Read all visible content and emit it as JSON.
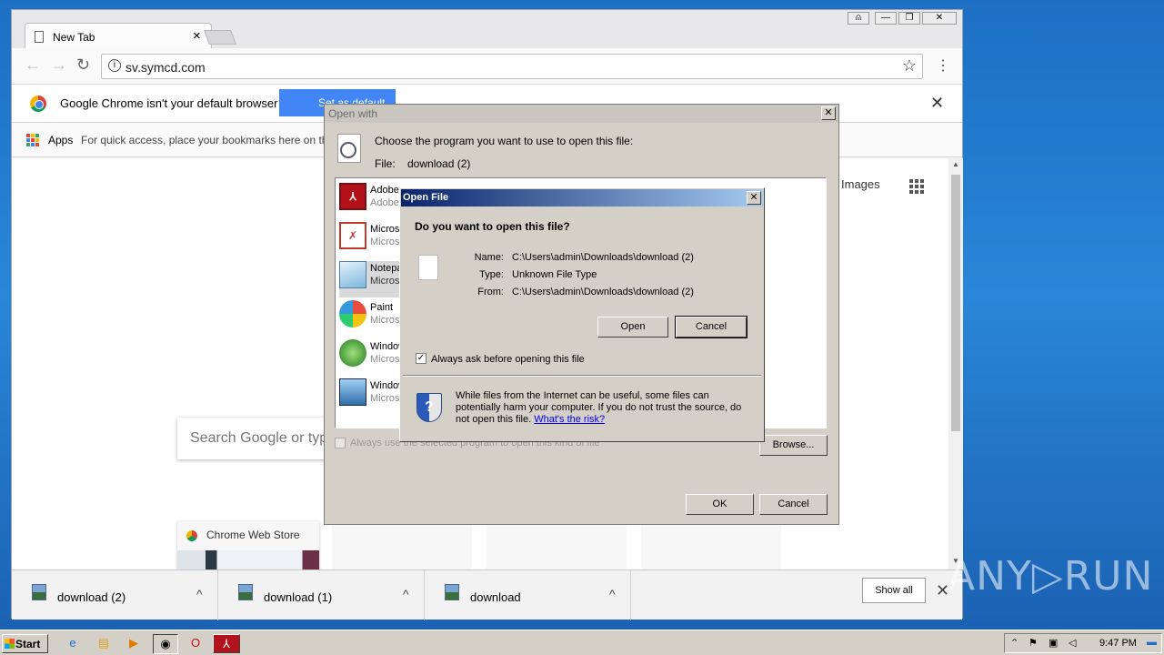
{
  "browser": {
    "tab_title": "New Tab",
    "tab_close": "×",
    "url": "sv.symcd.com",
    "window_controls": {
      "user": "⍝",
      "minimize": "—",
      "restore": "❐",
      "close": "✕"
    },
    "infobar": {
      "message": "Google Chrome isn't your default browser",
      "set_default_label": "Set as default"
    },
    "bookmarks": {
      "apps_label": "Apps",
      "hint": "For quick access, place your bookmarks here on the bookmarks bar."
    },
    "new_tab_page": {
      "images_link": "Images",
      "search_placeholder": "Search Google or type URL",
      "tiles": [
        {
          "label": "Chrome Web Store"
        }
      ]
    },
    "downloads": {
      "items": [
        {
          "name": "download (2)"
        },
        {
          "name": "download (1)"
        },
        {
          "name": "download"
        }
      ],
      "show_all": "Show all"
    }
  },
  "open_with_dialog": {
    "title": "Open with",
    "prompt": "Choose the program you want to use to open this file:",
    "file_label": "File:",
    "file_name": "download (2)",
    "programs": [
      {
        "name": "Adobe",
        "vendor": "Adobe",
        "icon": "adobe-pdf-icon"
      },
      {
        "name": "Microsoft",
        "vendor": "Microsoft",
        "icon": "office-icon"
      },
      {
        "name": "Notepad",
        "vendor": "Microsoft",
        "icon": "notepad-icon"
      },
      {
        "name": "Paint",
        "vendor": "Microsoft",
        "icon": "paint-icon"
      },
      {
        "name": "Windows",
        "vendor": "Microsoft",
        "icon": "windows-media-icon"
      },
      {
        "name": "Windows",
        "vendor": "Microsoft",
        "icon": "photo-viewer-icon"
      }
    ],
    "always_use_label": "Always use the selected program to open this kind of file",
    "browse_button": "Browse...",
    "ok_button": "OK",
    "cancel_button": "Cancel"
  },
  "open_file_dialog": {
    "title": "Open File",
    "question": "Do you want to open this file?",
    "fields": [
      {
        "key": "Name:",
        "value": "C:\\Users\\admin\\Downloads\\download (2)"
      },
      {
        "key": "Type:",
        "value": "Unknown File Type"
      },
      {
        "key": "From:",
        "value": "C:\\Users\\admin\\Downloads\\download (2)"
      }
    ],
    "open_button": "Open",
    "cancel_button": "Cancel",
    "always_ask_label": "Always ask before opening this file",
    "always_ask_checked": true,
    "warning_text": "While files from the Internet can be useful, some files can potentially harm your computer. If you do not trust the source, do not open this file.",
    "risk_link": "What's the risk?"
  },
  "taskbar": {
    "start_label": "Start",
    "clock": "9:47 PM"
  },
  "watermark": "ANY▷RUN",
  "colors": {
    "chrome_blue": "#4285f4",
    "win98_title": "#0a246a",
    "desktop": "#2a86d8"
  }
}
